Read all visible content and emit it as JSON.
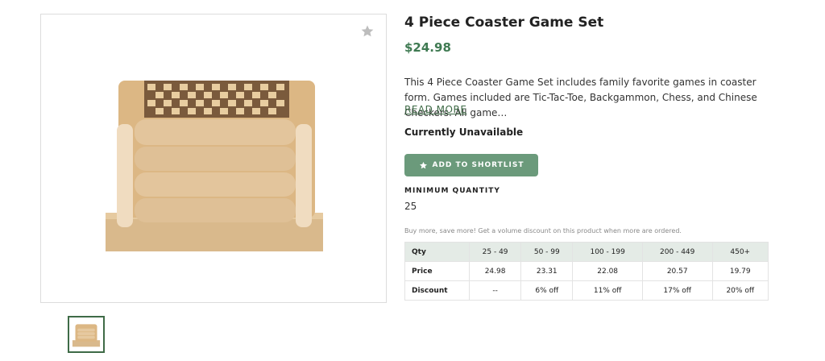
{
  "product": {
    "title": "4 Piece Coaster Game Set",
    "price": "$24.98",
    "description": "This 4 Piece Coaster Game Set includes family favorite games in coaster form. Games included are Tic-Tac-Toe, Backgammon, Chess, and Chinese Checkers. All game…",
    "read_more": "READ MORE",
    "availability": "Currently Unavailable"
  },
  "actions": {
    "shortlist_label": "ADD TO SHORTLIST"
  },
  "minimum_quantity": {
    "label": "MINIMUM QUANTITY",
    "value": "25"
  },
  "volume_discount": {
    "note": "Buy more, save more! Get a volume discount on this product when more are ordered.",
    "header": {
      "label": "Qty",
      "cols": [
        "25 - 49",
        "50 - 99",
        "100 - 199",
        "200 - 449",
        "450+"
      ]
    },
    "rows": [
      {
        "label": "Price",
        "cols": [
          "24.98",
          "23.31",
          "22.08",
          "20.57",
          "19.79"
        ]
      },
      {
        "label": "Discount",
        "cols": [
          "--",
          "6% off",
          "11% off",
          "17% off",
          "20% off"
        ]
      }
    ]
  },
  "icons": {
    "favorite": "star-icon",
    "shortlist": "star-icon"
  },
  "colors": {
    "accent": "#3f6b47",
    "price": "#3f7a52",
    "button": "#6b9a7b",
    "table_header": "#e4ebe6"
  }
}
